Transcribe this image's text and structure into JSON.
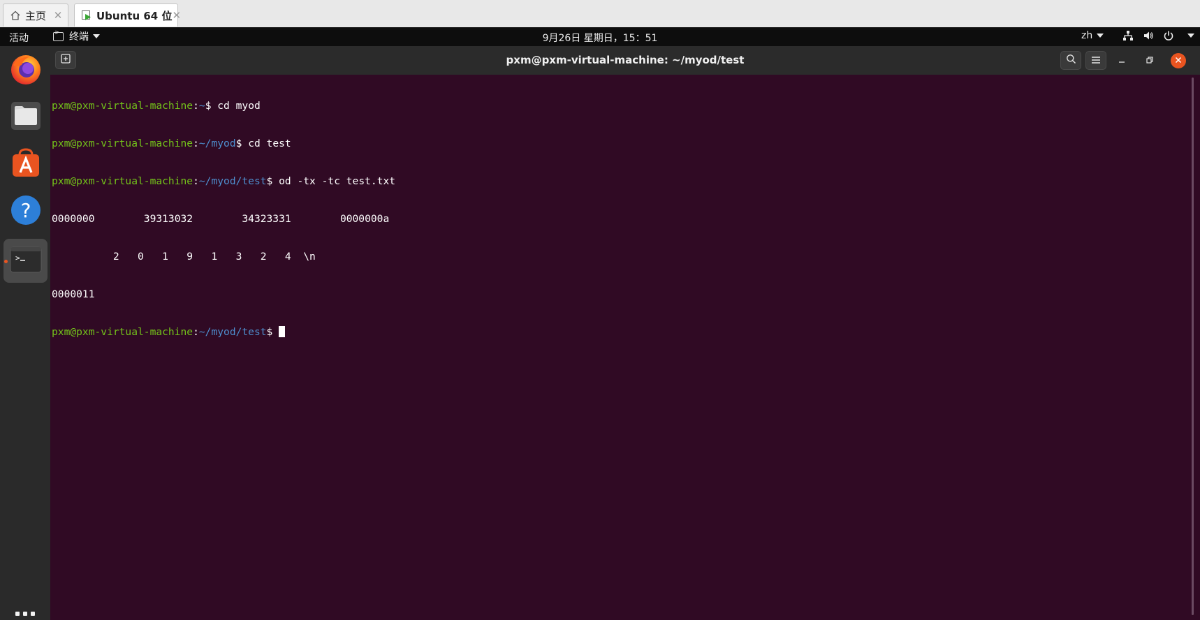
{
  "vm_tabs": [
    {
      "label": "主页",
      "icon": "home-icon"
    },
    {
      "label": "Ubuntu 64 位",
      "icon": "vm-running-icon"
    }
  ],
  "topbar": {
    "activities": "活动",
    "app_menu": "终端",
    "clock": "9月26日 星期日，15：51",
    "lang": "zh",
    "tray_icons": [
      "network-icon",
      "volume-icon",
      "power-icon"
    ]
  },
  "dock": {
    "items": [
      "firefox-icon",
      "files-icon",
      "app-store-icon",
      "help-icon",
      "terminal-icon"
    ],
    "active": "terminal-icon",
    "show_apps": "show-applications-icon"
  },
  "terminal": {
    "title": "pxm@pxm-virtual-machine: ~/myod/test",
    "lines": [
      {
        "user": "pxm@pxm-virtual-machine",
        "sep": ":",
        "path": "~",
        "prompt": "$ ",
        "cmd": "cd myod"
      },
      {
        "user": "pxm@pxm-virtual-machine",
        "sep": ":",
        "path": "~/myod",
        "prompt": "$ ",
        "cmd": "cd test"
      },
      {
        "user": "pxm@pxm-virtual-machine",
        "sep": ":",
        "path": "~/myod/test",
        "prompt": "$ ",
        "cmd": "od -tx -tc test.txt"
      },
      {
        "output": "0000000        39313032        34323331        0000000a"
      },
      {
        "output": "          2   0   1   9   1   3   2   4  \\n"
      },
      {
        "output": "0000011"
      },
      {
        "user": "pxm@pxm-virtual-machine",
        "sep": ":",
        "path": "~/myod/test",
        "prompt": "$ ",
        "cmd": "",
        "cursor": true
      }
    ]
  }
}
